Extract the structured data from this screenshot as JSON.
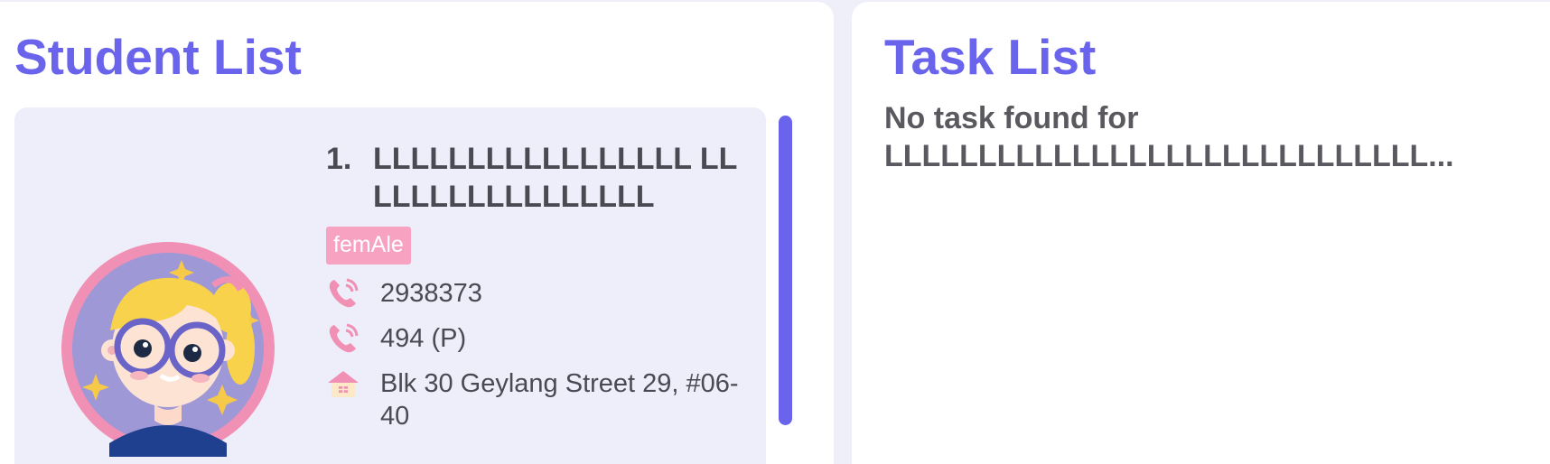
{
  "student_panel": {
    "title": "Student List",
    "students": [
      {
        "index": "1.",
        "name": "LLLLLLLLLLLLLLLLL LLLLLLLLLLLLLLLLL",
        "gender": "femAle",
        "phone": "2938373",
        "secondary_phone": "494 (P)",
        "address": "Blk 30 Geylang Street 29, #06-40"
      }
    ]
  },
  "task_panel": {
    "title": "Task List",
    "empty_message": "No task found for LLLLLLLLLLLLLLLLLLLLLLLLLLLLL..."
  },
  "colors": {
    "accent": "#6a64ec",
    "tag_pink": "#f8a2c2",
    "card_bg": "#eeedfa"
  }
}
